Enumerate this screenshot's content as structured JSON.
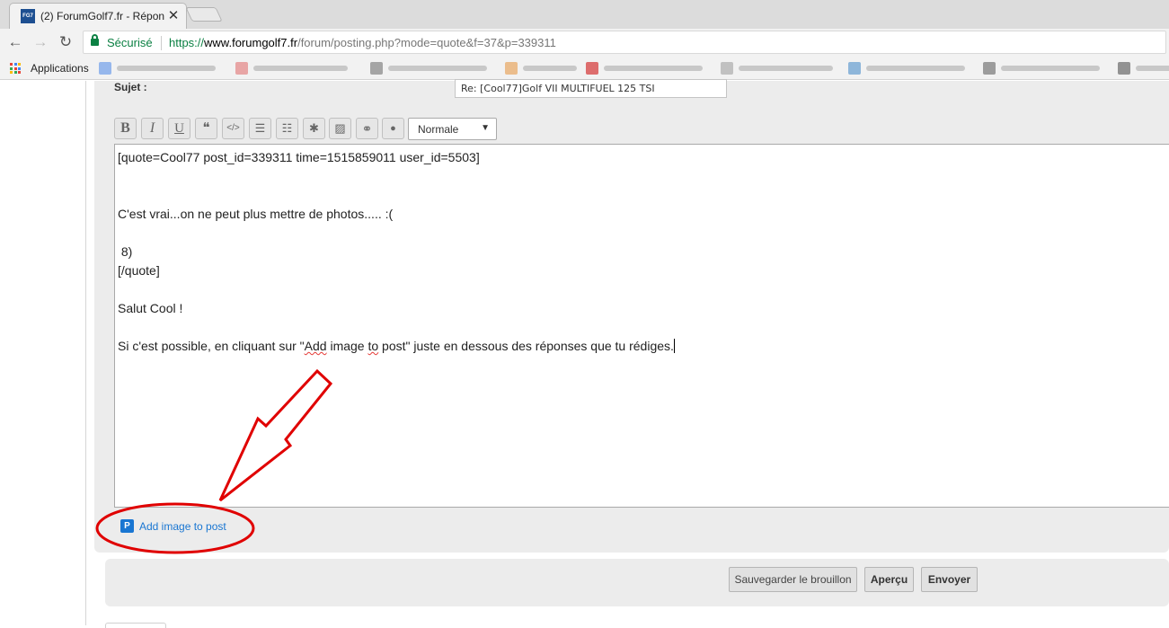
{
  "browser": {
    "tab": {
      "favicon_text": "FG7",
      "title": "(2) ForumGolf7.fr - Répon",
      "close": "✕"
    },
    "nav": {
      "back": "←",
      "forward": "→",
      "reload": "↻"
    },
    "omnibox": {
      "security_label": "Sécurisé",
      "url_scheme": "https://",
      "url_host": "www.forumgolf7.fr",
      "url_path": "/forum/posting.php?mode=quote&f=37&p=339311"
    },
    "bookmarks": {
      "apps_label": "Applications",
      "items": [
        {
          "icon_color": "#4a86e8"
        },
        {
          "icon_color": "#e06666"
        },
        {
          "icon_color": "#666666"
        },
        {
          "icon_color": "#e69138"
        },
        {
          "icon_color": "#cc0000"
        },
        {
          "icon_color": "#999999"
        },
        {
          "icon_color": "#3d85c6"
        },
        {
          "icon_color": "#555555"
        },
        {
          "icon_color": "#444444"
        }
      ]
    }
  },
  "form": {
    "subject_label": "Sujet :",
    "subject_value": "Re: [Cool77]Golf VII MULTIFUEL 125 TSI",
    "toolbar": {
      "bold": "B",
      "italic": "I",
      "underline": "U",
      "quote": "❝",
      "code": "</>",
      "list": "☰",
      "list_numbered": "☷",
      "list_item": "✱",
      "image": "▨",
      "link": "⚭",
      "color": "●",
      "font_size": "Normale",
      "font_size_caret": "▼"
    },
    "editor": {
      "line1": "[quote=Cool77 post_id=339311 time=1515859011 user_id=5503]",
      "line2": "C'est vrai...on ne peut plus mettre de photos..... :(",
      "line3": " 8)",
      "line4": "[/quote]",
      "line5": "Salut Cool !",
      "line6_a": "Si c'est possible, en cliquant sur \"",
      "line6_add": "Add",
      "line6_b": " image ",
      "line6_to": "to",
      "line6_c": " post\" juste en dessous des réponses que tu rédiges."
    },
    "add_image": {
      "icon": "P",
      "label": "Add image to post"
    },
    "buttons": {
      "save_draft": "Sauvegarder le brouillon",
      "preview": "Aperçu",
      "submit": "Envoyer"
    }
  },
  "colors": {
    "annotation": "#e00000",
    "link": "#1976d2",
    "secure": "#0b8043"
  }
}
